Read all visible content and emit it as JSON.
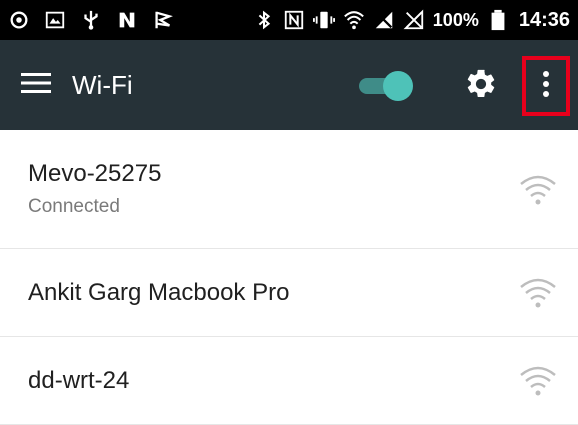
{
  "status_bar": {
    "icons": [
      "gear-alt-icon",
      "image-icon",
      "usb-icon",
      "n-logo-icon",
      "flag-icon",
      "bluetooth-icon",
      "nfc-icon",
      "vibrate-icon",
      "wifi-signal-icon",
      "no-signal-icon",
      "no-sim-icon"
    ],
    "battery_percent": "100%",
    "time": "14:36"
  },
  "app_bar": {
    "title": "Wi-Fi",
    "toggle_on": true,
    "colors": {
      "background": "#263238",
      "toggle_thumb": "#4ec2b8",
      "toggle_track": "#3f8c88",
      "highlight": "#e8001c"
    }
  },
  "networks": [
    {
      "name": "Mevo-25275",
      "status": "Connected"
    },
    {
      "name": "Ankit Garg Macbook Pro"
    },
    {
      "name": "dd-wrt-24"
    }
  ]
}
